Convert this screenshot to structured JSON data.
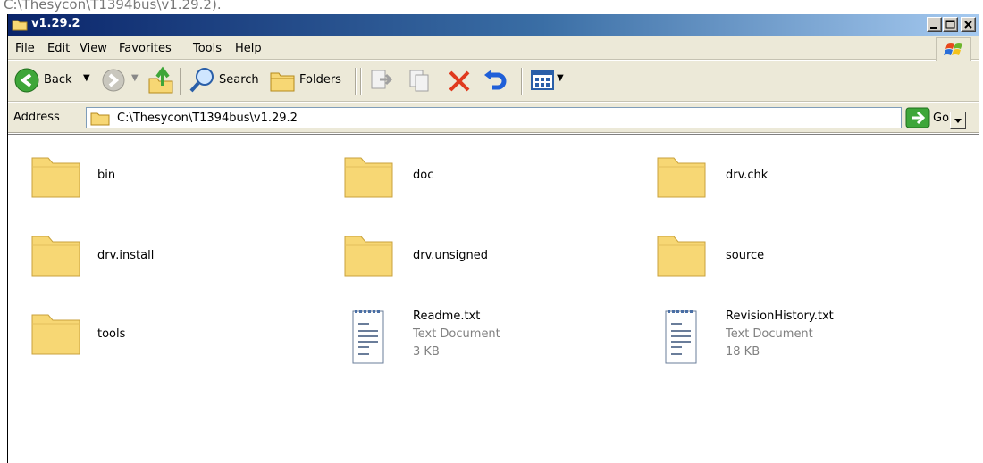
{
  "page_header": "C:\\Thesycon\\T1394bus\\v1.29.2).",
  "window": {
    "title": "v1.29.2"
  },
  "menu": {
    "items": [
      "File",
      "Edit",
      "View",
      "Favorites",
      "Tools",
      "Help"
    ]
  },
  "toolbar": {
    "back_label": "Back",
    "search_label": "Search",
    "folders_label": "Folders"
  },
  "address": {
    "label": "Address",
    "path": "C:\\Thesycon\\T1394bus\\v1.29.2",
    "go_label": "Go"
  },
  "files": [
    {
      "name": "bin",
      "type": "folder"
    },
    {
      "name": "doc",
      "type": "folder"
    },
    {
      "name": "drv.chk",
      "type": "folder"
    },
    {
      "name": "drv.install",
      "type": "folder"
    },
    {
      "name": "drv.unsigned",
      "type": "folder"
    },
    {
      "name": "source",
      "type": "folder"
    },
    {
      "name": "tools",
      "type": "folder"
    },
    {
      "name": "Readme.txt",
      "type": "text",
      "kind": "Text Document",
      "size": "3 KB"
    },
    {
      "name": "RevisionHistory.txt",
      "type": "text",
      "kind": "Text Document",
      "size": "18 KB"
    }
  ],
  "colors": {
    "titlebar": "#0a246a",
    "chrome": "#ece9d8",
    "folder": "#f7d774",
    "close_x": "#e03a1e"
  }
}
